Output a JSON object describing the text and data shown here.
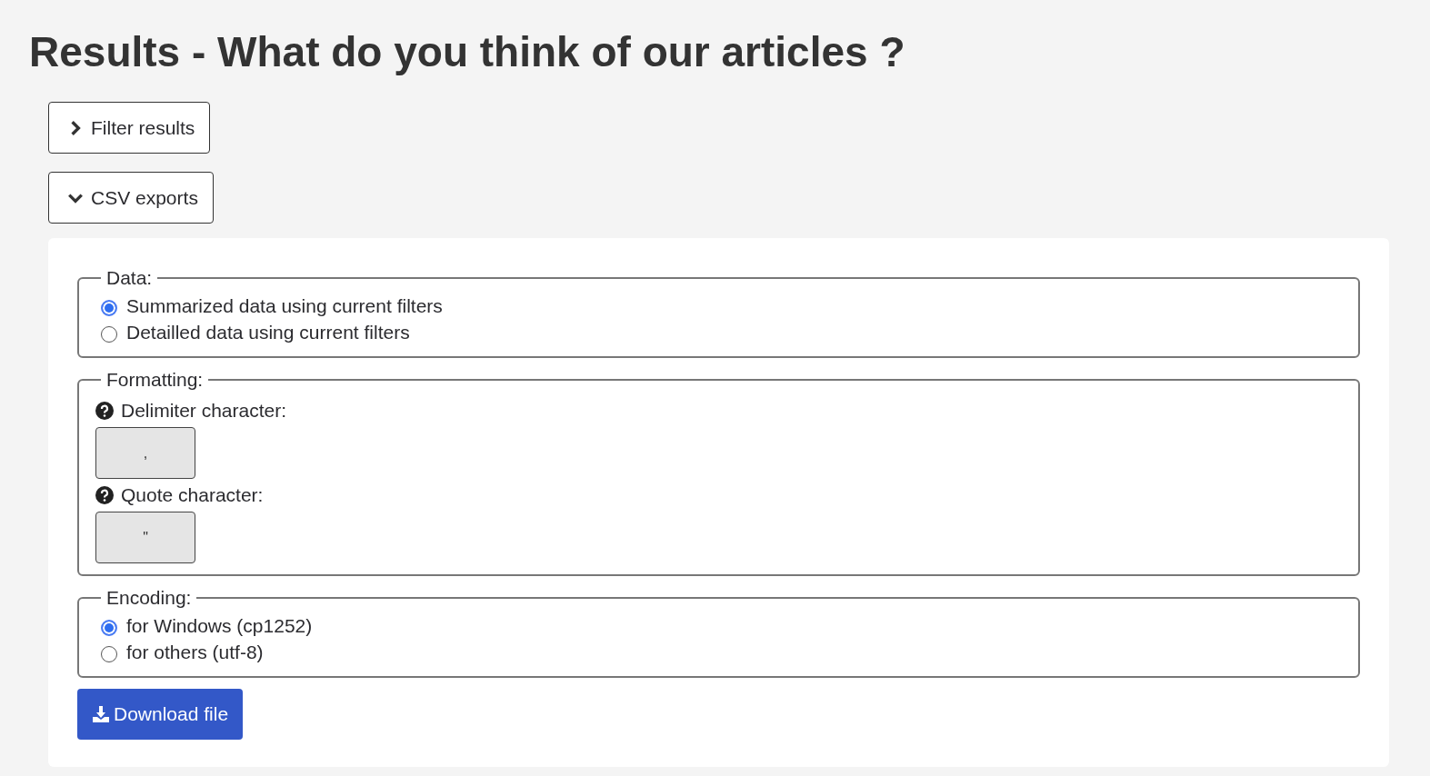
{
  "title": "Results - What do you think of our articles ?",
  "toggles": [
    {
      "label": "Filter results",
      "expanded": false
    },
    {
      "label": "CSV exports",
      "expanded": true
    }
  ],
  "sections": [
    {
      "kind": "radio",
      "legend": "Data:",
      "options": [
        {
          "label": "Summarized data using current filters",
          "selected": true
        },
        {
          "label": "Detailled data using current filters",
          "selected": false
        }
      ]
    },
    {
      "kind": "fields",
      "legend": "Formatting:",
      "fields": [
        {
          "label": "Delimiter character:",
          "value": ","
        },
        {
          "label": "Quote character:",
          "value": "\""
        }
      ]
    },
    {
      "kind": "radio",
      "legend": "Encoding:",
      "options": [
        {
          "label": "for Windows (cp1252)",
          "selected": true
        },
        {
          "label": "for others (utf-8)",
          "selected": false
        }
      ]
    }
  ],
  "download_button": "Download file"
}
